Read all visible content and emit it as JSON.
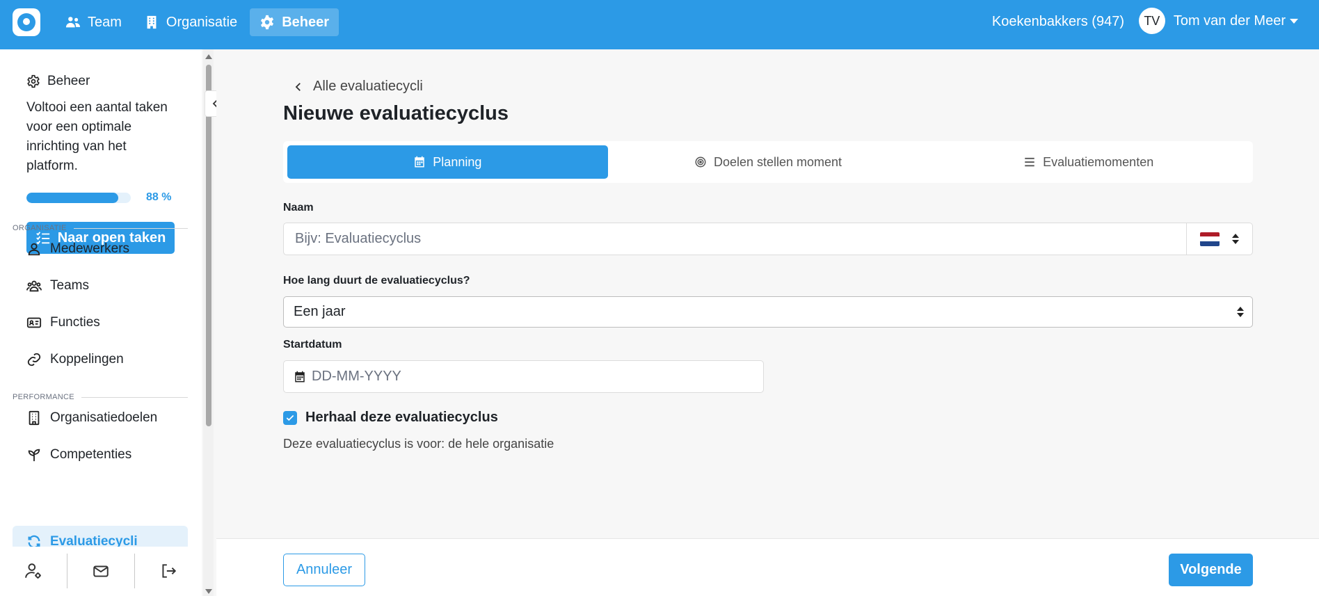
{
  "topbar": {
    "nav": [
      {
        "label": "Team",
        "icon": "users-icon"
      },
      {
        "label": "Organisatie",
        "icon": "building-icon"
      },
      {
        "label": "Beheer",
        "icon": "gear-icon",
        "active": true
      }
    ],
    "organization": "Koekenbakkers (947)",
    "user": {
      "initials": "TV",
      "name": "Tom van der Meer"
    }
  },
  "sidebar": {
    "title": "Beheer",
    "description": "Voltooi een aantal taken voor een optimale inrichting van het platform.",
    "progress": {
      "value": 88,
      "label": "88 %"
    },
    "tasks_button": "Naar open taken",
    "sections": [
      {
        "label": "ORGANISATIE",
        "items": [
          {
            "label": "Medewerkers",
            "icon": "user-icon"
          },
          {
            "label": "Teams",
            "icon": "users-icon"
          },
          {
            "label": "Functies",
            "icon": "id-card-icon"
          },
          {
            "label": "Koppelingen",
            "icon": "link-icon"
          }
        ]
      },
      {
        "label": "PERFORMANCE",
        "items": [
          {
            "label": "Organisatiedoelen",
            "icon": "building-icon"
          },
          {
            "label": "Competenties",
            "icon": "seedling-icon"
          },
          {
            "label": "Evaluatiecycli",
            "icon": "refresh-icon",
            "active": true
          }
        ]
      }
    ],
    "bottom_buttons": [
      "user-settings-icon",
      "mail-icon",
      "logout-icon"
    ]
  },
  "main": {
    "back_link": "Alle evaluatiecycli",
    "title": "Nieuwe evaluatiecyclus",
    "tabs": [
      {
        "label": "Planning",
        "icon": "calendar-icon",
        "active": true
      },
      {
        "label": "Doelen stellen moment",
        "icon": "target-icon"
      },
      {
        "label": "Evaluatiemomenten",
        "icon": "list-icon"
      }
    ],
    "name_field": {
      "label": "Naam",
      "placeholder": "Bijv: Evaluatiecyclus",
      "language": "nl-flag"
    },
    "duration_field": {
      "label": "Hoe lang duurt de evaluatiecyclus?",
      "value": "Een jaar"
    },
    "start_field": {
      "label": "Startdatum",
      "placeholder": "DD-MM-YYYY"
    },
    "repeat_checkbox": {
      "label": "Herhaal deze evaluatiecyclus",
      "checked": true
    },
    "scope_text": "Deze evaluatiecyclus is voor: de hele organisatie"
  },
  "footer": {
    "cancel": "Annuleer",
    "next": "Volgende"
  },
  "colors": {
    "accent": "#2c9ae6",
    "background": "#f7f7f7",
    "active_bg": "#e4f1fb"
  }
}
